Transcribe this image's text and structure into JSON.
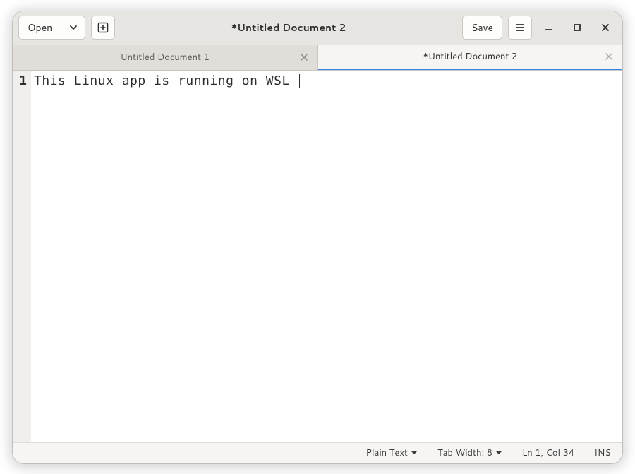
{
  "header": {
    "open_label": "Open",
    "save_label": "Save",
    "title": "*Untitled Document 2"
  },
  "tabs": [
    {
      "label": "Untitled Document 1",
      "active": false
    },
    {
      "label": "*Untitled Document 2",
      "active": true
    }
  ],
  "editor": {
    "line_number": "1",
    "content": "This Linux app is running on WSL "
  },
  "statusbar": {
    "language": "Plain Text",
    "tab_width_label": "Tab Width: 8",
    "position": "Ln 1, Col 34",
    "insert_mode": "INS"
  }
}
